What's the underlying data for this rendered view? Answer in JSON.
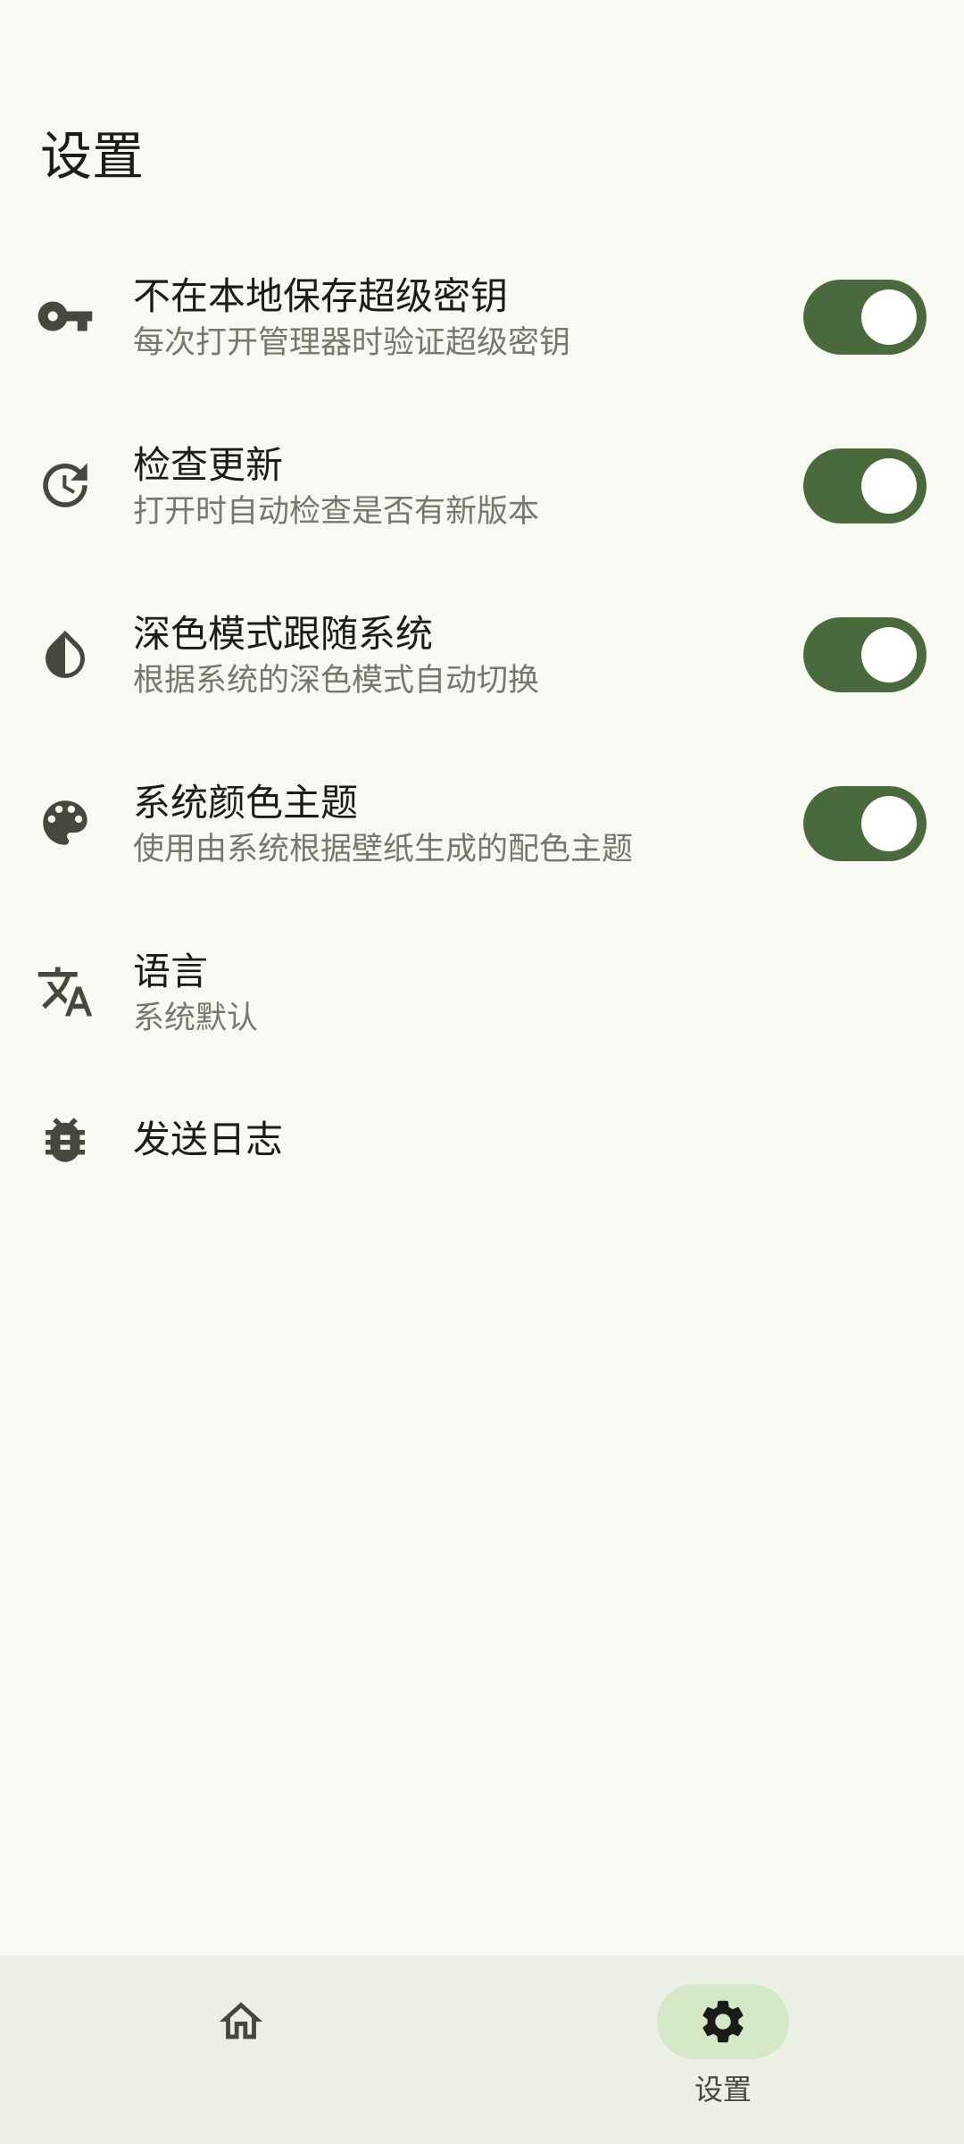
{
  "header": {
    "title": "设置"
  },
  "settings": {
    "items": [
      {
        "title": "不在本地保存超级密钥",
        "subtitle": "每次打开管理器时验证超级密钥",
        "icon": "key-icon",
        "toggle": true
      },
      {
        "title": "检查更新",
        "subtitle": "打开时自动检查是否有新版本",
        "icon": "update-icon",
        "toggle": true
      },
      {
        "title": "深色模式跟随系统",
        "subtitle": "根据系统的深色模式自动切换",
        "icon": "contrast-icon",
        "toggle": true
      },
      {
        "title": "系统颜色主题",
        "subtitle": "使用由系统根据壁纸生成的配色主题",
        "icon": "palette-icon",
        "toggle": true
      },
      {
        "title": "语言",
        "subtitle": "系统默认",
        "icon": "translate-icon"
      },
      {
        "title": "发送日志",
        "icon": "bug-icon"
      }
    ]
  },
  "bottom_nav": {
    "items": [
      {
        "label": "",
        "icon": "home-icon",
        "active": false
      },
      {
        "label": "设置",
        "icon": "gear-icon",
        "active": true
      }
    ]
  },
  "colors": {
    "background": "#f8f9f2",
    "accent": "#4a6a3e",
    "nav_background": "#ecefe5",
    "nav_active_pill": "#d4e8c8",
    "icon": "#44483f",
    "subtitle": "#74786f"
  }
}
